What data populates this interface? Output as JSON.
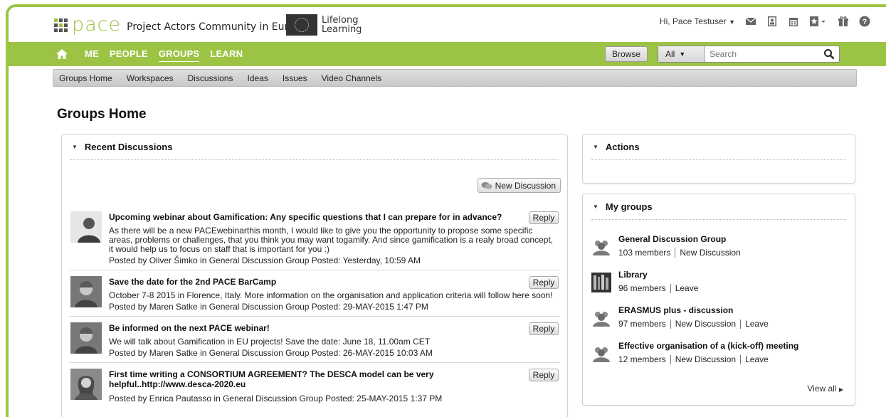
{
  "header": {
    "logo_word": "pace",
    "logo_tagline": "Project Actors Community in Europe",
    "lifelong_line1": "Lifelong",
    "lifelong_line2": "Learning",
    "greeting": "Hi, Pace Testuser",
    "icons": [
      "mail-icon",
      "contact-card-icon",
      "calendar-icon",
      "bookmark-icon",
      "gift-icon",
      "help-icon"
    ]
  },
  "nav": {
    "items": [
      "ME",
      "PEOPLE",
      "GROUPS",
      "LEARN"
    ],
    "active": "GROUPS",
    "browse_label": "Browse",
    "search_scope": "All",
    "search_placeholder": "Search"
  },
  "subnav": {
    "items": [
      "Groups Home",
      "Workspaces",
      "Discussions",
      "Ideas",
      "Issues",
      "Video Channels"
    ]
  },
  "page": {
    "title": "Groups Home"
  },
  "discussions": {
    "title": "Recent Discussions",
    "new_button": "New Discussion",
    "reply_label": "Reply",
    "items": [
      {
        "title": "Upcoming webinar about Gamification: Any specific questions that I can prepare for in advance?",
        "body": "As there will be a new PACEwebinarthis month, I would like to give you the opportunity to propose some specific areas, problems or challenges, that you think you may want togamify. And since gamification is a realy broad concept, it would help us to focus on staff that is important for you :)",
        "meta": "Posted by Oliver Šimko in General Discussion Group Posted: Yesterday, 10:59 AM"
      },
      {
        "title": "Save the date for the 2nd PACE BarCamp",
        "body": "October 7-8 2015 in Florence, Italy. More information on the organisation and application criteria will follow here soon!",
        "meta": "Posted by Maren Satke in General Discussion Group Posted: 29-MAY-2015 1:47 PM"
      },
      {
        "title": "Be informed on the next PACE webinar!",
        "body": "We will talk about Gamification in EU projects! Save the date: June 18, 11.00am CET",
        "meta": "Posted by Maren Satke in General Discussion Group Posted: 26-MAY-2015 10:03 AM"
      },
      {
        "title": "First time writing a CONSORTIUM AGREEMENT? The DESCA model can be very helpful..http://www.desca-2020.eu",
        "body": "",
        "meta": "Posted by Enrica Pautasso in General Discussion Group Posted: 25-MAY-2015 1:37 PM"
      }
    ]
  },
  "actions": {
    "title": "Actions"
  },
  "my_groups": {
    "title": "My groups",
    "view_all": "View all",
    "items": [
      {
        "name": "General Discussion Group",
        "members": "103 members",
        "links": [
          "New Discussion"
        ]
      },
      {
        "name": "Library",
        "members": "96 members",
        "links": [
          "Leave"
        ]
      },
      {
        "name": "ERASMUS plus - discussion",
        "members": "97 members",
        "links": [
          "New Discussion",
          "Leave"
        ]
      },
      {
        "name": "Effective organisation of a (kick-off) meeting",
        "members": "12 members",
        "links": [
          "New Discussion",
          "Leave"
        ]
      }
    ]
  },
  "colors": {
    "brand_green": "#9cc444"
  }
}
